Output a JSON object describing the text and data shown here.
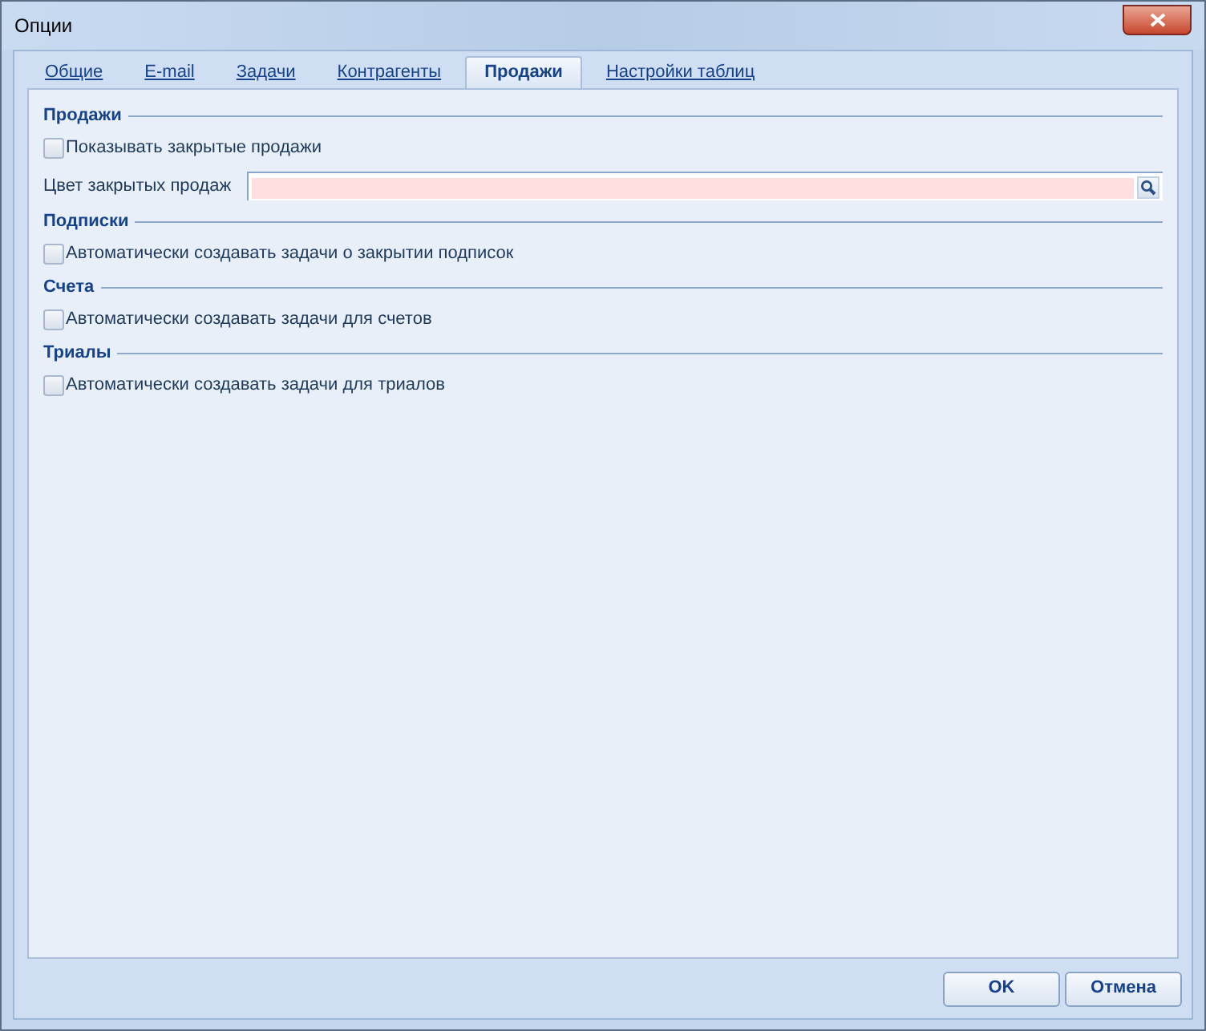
{
  "window": {
    "title": "Опции"
  },
  "tabs": [
    {
      "label": "Общие",
      "selected": false
    },
    {
      "label": "E-mail",
      "selected": false
    },
    {
      "label": "Задачи",
      "selected": false
    },
    {
      "label": "Контрагенты",
      "selected": false
    },
    {
      "label": "Продажи",
      "selected": true
    },
    {
      "label": "Настройки таблиц",
      "selected": false
    }
  ],
  "sections": [
    {
      "title": "Продажи",
      "items": [
        {
          "kind": "checkbox",
          "label": "Показывать закрытые продажи",
          "checked": false
        },
        {
          "kind": "color_field",
          "label": "Цвет закрытых продаж",
          "color": "#ffdfdf"
        }
      ]
    },
    {
      "title": "Подписки",
      "items": [
        {
          "kind": "checkbox",
          "label": "Автоматически создавать задачи о закрытии подписок",
          "checked": false
        }
      ]
    },
    {
      "title": "Счета",
      "items": [
        {
          "kind": "checkbox",
          "label": "Автоматически создавать задачи для счетов",
          "checked": false
        }
      ]
    },
    {
      "title": "Триалы",
      "items": [
        {
          "kind": "checkbox",
          "label": "Автоматически создавать задачи для триалов",
          "checked": false
        }
      ]
    }
  ],
  "buttons": [
    "OK",
    "Отмена"
  ]
}
